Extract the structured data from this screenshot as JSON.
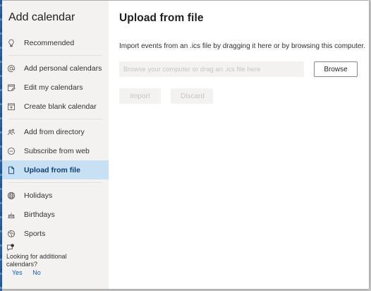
{
  "sidebar": {
    "title": "Add calendar",
    "groups": [
      [
        {
          "label": "Recommended",
          "icon": "lightbulb-icon"
        }
      ],
      [
        {
          "label": "Add personal calendars",
          "icon": "at-sign-icon"
        },
        {
          "label": "Edit my calendars",
          "icon": "calendar-edit-icon"
        },
        {
          "label": "Create blank calendar",
          "icon": "calendar-add-icon"
        }
      ],
      [
        {
          "label": "Add from directory",
          "icon": "people-icon"
        },
        {
          "label": "Subscribe from web",
          "icon": "link-icon"
        },
        {
          "label": "Upload from file",
          "icon": "document-icon",
          "selected": true
        }
      ],
      [
        {
          "label": "Holidays",
          "icon": "globe-icon"
        },
        {
          "label": "Birthdays",
          "icon": "cake-icon"
        },
        {
          "label": "Sports",
          "icon": "sports-icon"
        }
      ]
    ],
    "feedback": {
      "question": "Looking for additional calendars?",
      "yes": "Yes",
      "no": "No"
    }
  },
  "main": {
    "title": "Upload from file",
    "description": "Import events from an .ics file by dragging it here or by browsing this computer.",
    "file_input_placeholder": "Browse your computer or drag an .ics file here",
    "browse_label": "Browse",
    "import_label": "Import",
    "discard_label": "Discard"
  },
  "colors": {
    "sidebar_bg": "#f3f2f1",
    "selected_bg": "#c7e0f4",
    "link": "#0a5eb5"
  }
}
